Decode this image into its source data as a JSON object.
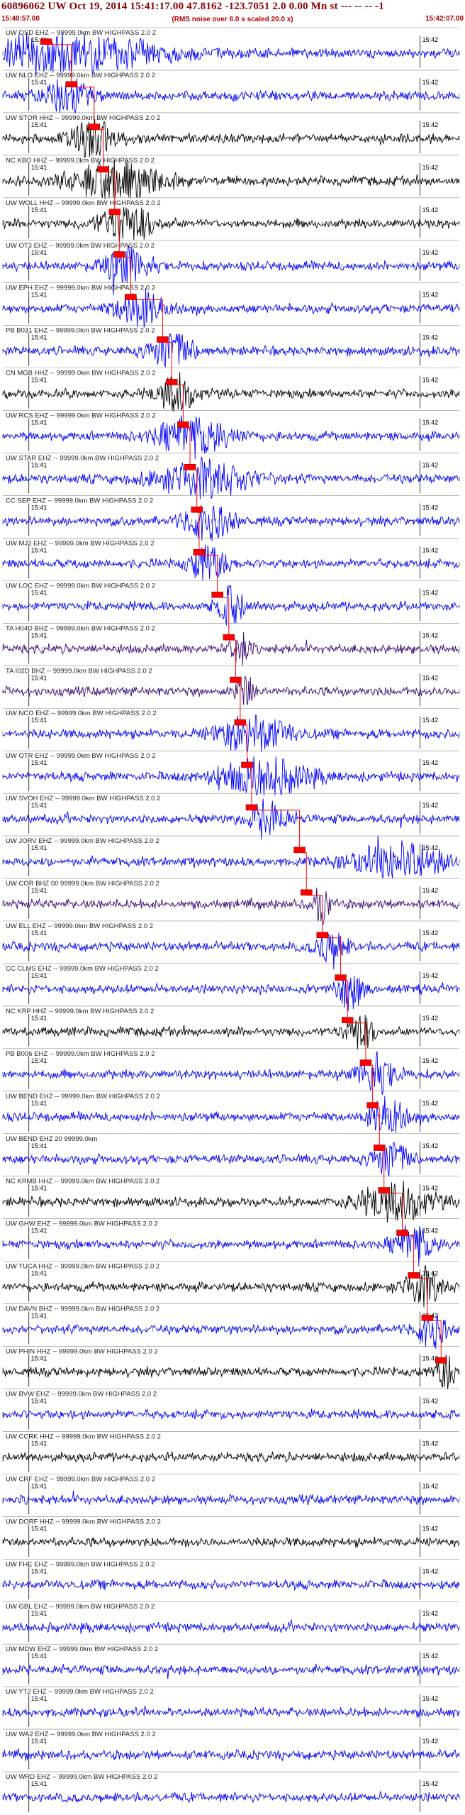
{
  "header": {
    "title": "60896062 UW Oct 19, 2014 15:41:17.00   47.8162 -123.7051  2.0 0.00 Mn st --- -- --  -1",
    "start_time": "15:40:57.00",
    "end_time": "15:42:07.00",
    "note": "(RMS noise over 6.0 s scaled 20.0 x)"
  },
  "minute_labels": {
    "first": "15:41",
    "second": "15:42"
  },
  "colors": {
    "trace_blue": "#0000ff",
    "trace_black": "#000000",
    "trace_purple": "#3a0a78",
    "pick_red": "#ff0000",
    "label_dark": "#222222",
    "title_red": "#8b0000"
  },
  "traces": [
    {
      "label": "UW OSD EHZ -- 99999.0km BW  HIGHPASS  2.0  2",
      "color": "blue",
      "pick": 0.095,
      "burst": [
        0.13,
        0.22
      ]
    },
    {
      "label": "UW NLO EHZ -- 99999.0km BW  HIGHPASS  2.0  2",
      "color": "blue",
      "pick": 0.15,
      "burst": [
        0.14,
        0.05
      ]
    },
    {
      "label": "UW STOR HHZ -- 99999.0km BW  HIGHPASS  2.0  2",
      "color": "black",
      "pick": 0.2,
      "burst": [
        0.2,
        0.05
      ]
    },
    {
      "label": "NC KBO HHZ -- 99999.0km BW  HIGHPASS  2.0  2",
      "color": "black",
      "pick": 0.22,
      "burst": [
        0.25,
        0.1
      ]
    },
    {
      "label": "UW WOLL HHZ -- 99999.0km BW  HIGHPASS  2.0  2",
      "color": "black",
      "pick": 0.245,
      "burst": [
        0.27,
        0.06
      ]
    },
    {
      "label": "UW OT3 EHZ -- 99999.0km BW  HIGHPASS  2.0  2",
      "color": "blue",
      "pick": 0.255,
      "burst": [
        0.27,
        0.05
      ]
    },
    {
      "label": "UW EPH EHZ -- 99999.0km BW  HIGHPASS  2.0  2",
      "color": "blue",
      "pick": 0.28,
      "burst": [
        0.3,
        0.05
      ]
    },
    {
      "label": "PB B031 EHZ -- 99999.0km BW  HIGHPASS  2.0  2",
      "color": "blue",
      "pick": 0.35,
      "burst": [
        0.37,
        0.05
      ]
    },
    {
      "label": "CN MGB HHZ -- 99999.0km BW  HIGHPASS  2.0  2",
      "color": "black",
      "pick": 0.37,
      "burst": [
        0.38,
        0.04
      ]
    },
    {
      "label": "UW RCS EHZ -- 99999.0km BW  HIGHPASS  2.0  2",
      "color": "blue",
      "pick": 0.395,
      "burst": [
        0.42,
        0.08
      ]
    },
    {
      "label": "UW STAR EHZ -- 99999.0km BW  HIGHPASS  2.0  2",
      "color": "blue",
      "pick": 0.41,
      "burst": [
        0.44,
        0.1
      ]
    },
    {
      "label": "CC SEP EHZ -- 99999.0km BW  HIGHPASS  2.0  2",
      "color": "blue",
      "pick": 0.425,
      "burst": [
        0.45,
        0.05
      ]
    },
    {
      "label": "UW MJ2 EHZ -- 99999.0km BW  HIGHPASS  2.0  2",
      "color": "blue",
      "pick": 0.43,
      "burst": [
        0.45,
        0.04
      ]
    },
    {
      "label": "UW LOC EHZ -- 99999.0km BW  HIGHPASS  2.0  2",
      "color": "blue",
      "pick": 0.47,
      "burst": [
        0.5,
        0.03
      ]
    },
    {
      "label": "TA H04D BHZ -- 99999.0km BW  HIGHPASS  2.0  2",
      "color": "purple",
      "pick": 0.495,
      "burst": [
        0.52,
        0.02
      ]
    },
    {
      "label": "TA I02D BHZ -- 99999.0km BW  HIGHPASS  2.0  2",
      "color": "purple",
      "pick": 0.51,
      "burst": [
        0.53,
        0.02
      ]
    },
    {
      "label": "UW NCO EHZ -- 99999.0km BW  HIGHPASS  2.0  2",
      "color": "blue",
      "pick": 0.52,
      "burst": [
        0.55,
        0.08
      ]
    },
    {
      "label": "UW OTR EHZ -- 99999.0km BW  HIGHPASS  2.0  2",
      "color": "blue",
      "pick": 0.535,
      "burst": [
        0.57,
        0.1
      ]
    },
    {
      "label": "UW SVOH EHZ -- 99999.0km BW  HIGHPASS  2.0  2",
      "color": "blue",
      "pick": 0.545,
      "burst": [
        0.58,
        0.04
      ]
    },
    {
      "label": "UW JORV EHZ -- 99999.0km BW  HIGHPASS  2.0  2",
      "color": "blue",
      "pick": 0.65,
      "burst": [
        0.87,
        0.1
      ]
    },
    {
      "label": "UW COR BHZ 00 99999.0km BW  HIGHPASS  2.0  2",
      "color": "purple",
      "pick": 0.665,
      "burst": [
        0.7,
        0.02
      ]
    },
    {
      "label": "UW ELL EHZ -- 99999.0km BW  HIGHPASS  2.0  2",
      "color": "blue",
      "pick": 0.7,
      "burst": [
        0.72,
        0.03
      ]
    },
    {
      "label": "CC CLMS EHZ -- 99999.0km BW  HIGHPASS  2.0  2",
      "color": "blue",
      "pick": 0.74,
      "burst": [
        0.76,
        0.03
      ]
    },
    {
      "label": "NC KRP HHZ -- 99999.0km BW  HIGHPASS  2.0  2",
      "color": "black",
      "pick": 0.755,
      "burst": [
        0.78,
        0.03
      ]
    },
    {
      "label": "PB B006 EHZ -- 99999.0km BW  HIGHPASS  2.0  2",
      "color": "blue",
      "pick": 0.795,
      "burst": [
        0.82,
        0.04
      ]
    },
    {
      "label": "UW BEND EHZ -- 99999.0km BW  HIGHPASS  2.0  2",
      "color": "blue",
      "pick": 0.81,
      "burst": [
        0.84,
        0.04
      ]
    },
    {
      "label": "UW BEND EHZ 20 99999.0km",
      "color": "blue",
      "pick": 0.825,
      "burst": [
        0.85,
        0.04
      ]
    },
    {
      "label": "NC KRMB HHZ -- 99999.0km BW  HIGHPASS  2.0  2",
      "color": "black",
      "pick": 0.835,
      "burst": [
        0.86,
        0.08
      ]
    },
    {
      "label": "UW GHW EHZ -- 99999.0km BW  HIGHPASS  2.0  2",
      "color": "blue",
      "pick": 0.875,
      "burst": [
        0.9,
        0.04
      ]
    },
    {
      "label": "UW TUCA HHZ -- 99999.0km BW  HIGHPASS  2.0  2",
      "color": "black",
      "pick": 0.9,
      "burst": [
        0.92,
        0.04
      ]
    },
    {
      "label": "UW DAVN BHZ -- 99999.0km BW  HIGHPASS  2.0  2",
      "color": "blue",
      "pick": 0.93,
      "burst": [
        0.94,
        0.03
      ]
    },
    {
      "label": "UW PHIN HHZ -- 99999.0km BW  HIGHPASS  2.0  2",
      "color": "black",
      "pick": 0.96,
      "burst": [
        0.97,
        0.02
      ]
    },
    {
      "label": "UW BVW EHZ -- 99999.0km BW  HIGHPASS  2.0  2",
      "color": "blue",
      "pick": null,
      "burst": null
    },
    {
      "label": "UW CCRK HHZ -- 99999.0km BW  HIGHPASS  2.0  2",
      "color": "black",
      "pick": null,
      "burst": null
    },
    {
      "label": "UW CRF EHZ -- 99999.0km BW  HIGHPASS  2.0  2",
      "color": "blue",
      "pick": null,
      "burst": null
    },
    {
      "label": "UW DORF HHZ -- 99999.0km BW  HIGHPASS  2.0  2",
      "color": "black",
      "pick": null,
      "burst": null
    },
    {
      "label": "UW FHE EHZ -- 99999.0km BW  HIGHPASS  2.0  2",
      "color": "blue",
      "pick": null,
      "burst": null
    },
    {
      "label": "UW GBL EHZ -- 99999.0km BW  HIGHPASS  2.0  2",
      "color": "blue",
      "pick": null,
      "burst": null
    },
    {
      "label": "UW MDW EHZ -- 99999.0km BW  HIGHPASS  2.0  2",
      "color": "blue",
      "pick": null,
      "burst": null
    },
    {
      "label": "UW YT2 EHZ -- 99999.0km BW  HIGHPASS  2.0  2",
      "color": "blue",
      "pick": null,
      "burst": null
    },
    {
      "label": "UW WA2 EHZ -- 99999.0km BW  HIGHPASS  2.0  2",
      "color": "blue",
      "pick": null,
      "burst": null
    },
    {
      "label": "UW WRD EHZ -- 99999.0km BW  HIGHPASS  2.0  2",
      "color": "blue",
      "pick": null,
      "burst": null
    }
  ]
}
